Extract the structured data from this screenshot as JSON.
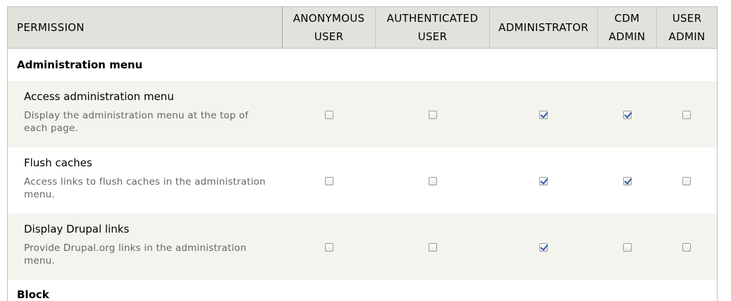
{
  "columns": [
    {
      "key": "permission",
      "label": "PERMISSION"
    },
    {
      "key": "anonymous",
      "label": "ANONYMOUS\nUSER"
    },
    {
      "key": "authenticated",
      "label": "AUTHENTICATED\nUSER"
    },
    {
      "key": "administrator",
      "label": "ADMINISTRATOR"
    },
    {
      "key": "cdm_admin",
      "label": "CDM\nADMIN"
    },
    {
      "key": "user_admin",
      "label": "USER\nADMIN"
    }
  ],
  "modules": [
    {
      "name": "Administration menu",
      "permissions": [
        {
          "title": "Access administration menu",
          "description": "Display the administration menu at the top of each page.",
          "checked": [
            false,
            false,
            true,
            true,
            false
          ]
        },
        {
          "title": "Flush caches",
          "description": "Access links to flush caches in the administration menu.",
          "checked": [
            false,
            false,
            true,
            true,
            false
          ]
        },
        {
          "title": "Display Drupal links",
          "description": "Provide Drupal.org links in the administration menu.",
          "checked": [
            false,
            false,
            true,
            false,
            false
          ]
        }
      ]
    }
  ],
  "next_module_partial": "Block",
  "colors": {
    "header_bg": "#e1e2dc",
    "odd_row_bg": "#f3f4ee",
    "checkmark": "#2d5aa8",
    "description_text": "#666666"
  }
}
